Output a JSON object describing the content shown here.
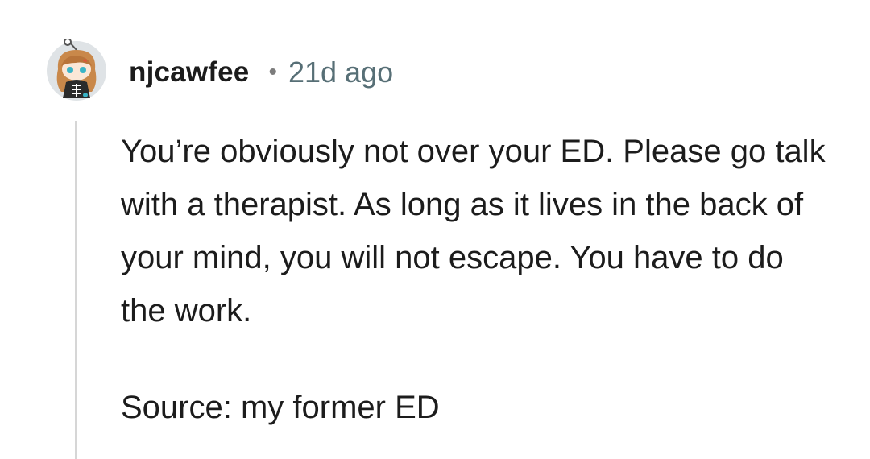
{
  "comment": {
    "username": "njcawfee",
    "separator": "•",
    "timestamp": "21d ago",
    "paragraphs": [
      "You’re obviously not over your ED. Please go talk with a therapist. As long as it lives in the back of your mind, you will not escape. You have to do the work.",
      "Source: my former ED"
    ],
    "avatar_icon": "snoo-avatar-icon"
  },
  "colors": {
    "username": "#1c1c1c",
    "timestamp": "#576f76",
    "thread_line": "#d6d6d6",
    "text": "#1c1c1c"
  }
}
